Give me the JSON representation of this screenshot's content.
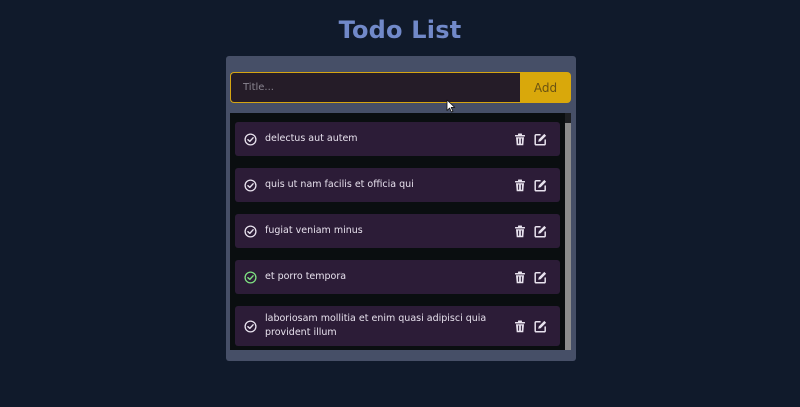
{
  "app": {
    "title": "Todo List"
  },
  "form": {
    "title_placeholder": "Title...",
    "title_value": "",
    "add_label": "Add"
  },
  "colors": {
    "page_background": "#101a2b",
    "title": "#7189c9",
    "panel": "#464f67",
    "accent": "#d9a80b",
    "item_background": "#2c1c37",
    "completed_check": "#7ee081"
  },
  "todos": [
    {
      "text": "delectus aut autem",
      "completed": false,
      "icons": [
        "check-circle-icon",
        "trash-icon",
        "edit-icon"
      ]
    },
    {
      "text": "quis ut nam facilis et officia qui",
      "completed": false,
      "icons": [
        "check-circle-icon",
        "trash-icon",
        "edit-icon"
      ]
    },
    {
      "text": "fugiat veniam minus",
      "completed": false,
      "icons": [
        "check-circle-icon",
        "trash-icon",
        "edit-icon"
      ]
    },
    {
      "text": "et porro tempora",
      "completed": true,
      "icons": [
        "check-circle-icon",
        "trash-icon",
        "edit-icon"
      ]
    },
    {
      "text": "laboriosam mollitia et enim quasi adipisci quia provident illum",
      "completed": false,
      "icons": [
        "check-circle-icon",
        "trash-icon",
        "edit-icon"
      ]
    }
  ]
}
